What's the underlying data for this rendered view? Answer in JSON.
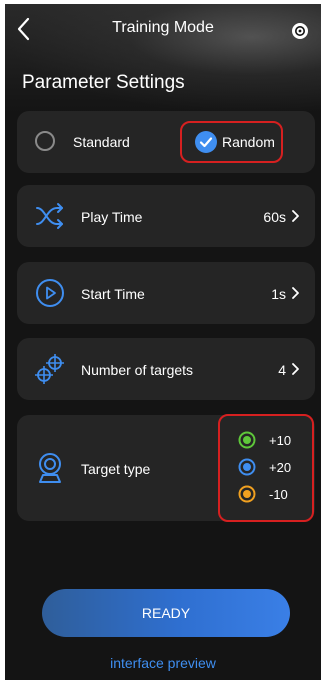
{
  "header": {
    "title": "Training Mode"
  },
  "section_title": "Parameter Settings",
  "mode": {
    "standard_label": "Standard",
    "random_label": "Random",
    "selected": "Random"
  },
  "play_time": {
    "label": "Play Time",
    "value": "60s"
  },
  "start_time": {
    "label": "Start Time",
    "value": "1s"
  },
  "number_of_targets": {
    "label": "Number of targets",
    "value": "4"
  },
  "target_type": {
    "label": "Target type",
    "options": [
      {
        "points": "+10",
        "color": "#5ec73a"
      },
      {
        "points": "+20",
        "color": "#3f8ef0"
      },
      {
        "points": "-10",
        "color": "#f0a020"
      }
    ]
  },
  "ready_label": "READY",
  "preview_label": "interface preview",
  "colors": {
    "accent": "#3f8ef0",
    "highlight": "#d62020",
    "card": "#252525",
    "background": "#141414"
  },
  "icons": {
    "back": "chevron-left-icon",
    "target": "target-icon",
    "shuffle": "shuffle-icon",
    "play": "play-circle-icon",
    "crosshair": "crosshair-icon",
    "target_type": "target-stand-icon"
  }
}
